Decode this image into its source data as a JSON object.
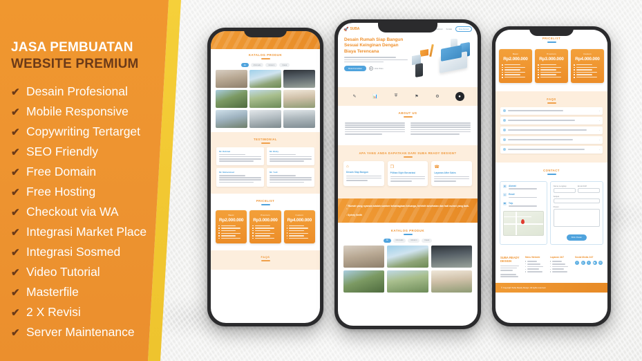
{
  "promo": {
    "title_line1": "JASA PEMBUATAN",
    "title_line2": "WEBSITE PREMIUM",
    "check_glyph": "✔",
    "features": [
      "Desain Profesional",
      "Mobile Responsive",
      "Copywriting Tertarget",
      "SEO Friendly",
      "Free Domain",
      "Free Hosting",
      "Checkout via WA",
      "Integrasi Market Place",
      "Integrasi Sosmed",
      "Video Tutorial",
      "Masterfile",
      "2 X Revisi",
      "Server Maintenance"
    ],
    "colors": {
      "panel_orange": "#ed9330",
      "accent_yellow": "#f2c832",
      "title_brown": "#6b3a18",
      "title_white": "#ffffff"
    }
  },
  "phone_left": {
    "catalog": {
      "heading": "KATALOG PRODUK",
      "filters": [
        "All",
        "Minimalis",
        "Modern",
        "Klasik"
      ],
      "active_filter": "All"
    },
    "testimonial": {
      "heading": "TESTIMONIAL",
      "cards": [
        {
          "name": "Mr. Rahmat"
        },
        {
          "name": "Mr. Rizky"
        },
        {
          "name": "Mr. Muhammad"
        },
        {
          "name": "Mr. Yudi"
        }
      ]
    },
    "pricelist": {
      "heading": "PRICELIST",
      "plans": [
        {
          "tier": "Basic",
          "price": "Rp2.000.000",
          "feature_count": 6
        },
        {
          "tier": "Premium",
          "price": "Rp3.000.000",
          "feature_count": 6
        },
        {
          "tier": "Custom",
          "price": "Rp4.000.000",
          "feature_count": 6
        }
      ]
    },
    "faqs_heading": "FAQS"
  },
  "phone_center": {
    "brand": {
      "logo_text": "SUBA",
      "logo_icon": "rocket-icon"
    },
    "nav": {
      "items": [
        "Home",
        "About",
        "Layanan",
        "Produk",
        "Testimoni",
        "Kontak"
      ],
      "active": "Home",
      "cta": "Free Konsul"
    },
    "hero": {
      "title": "Desain Rumah Siap Bangun Sesuai Keinginan Dengan Biaya Terencana",
      "primary_button": "Mulai Konsultasi",
      "play_button": "Lihat Video"
    },
    "about": {
      "heading": "ABOUT US"
    },
    "benefits": {
      "heading": "APA YANG ANDA DAPATKAN DARI SUBA READY DESIGN?",
      "cards": [
        {
          "title": "Desain Siap Bangun",
          "icon": "house-icon"
        },
        {
          "title": "Pilihan Style Bervariasi",
          "icon": "layers-icon"
        },
        {
          "title": "Layanan After Sales",
          "icon": "headset-icon"
        }
      ]
    },
    "quote": {
      "text": "\" Rumah yang nyaman adalah sumber kebahagiaan keluarga, terlebih kesehatan dan hati nurani yang baik. \"",
      "author": ": Sydney Smith"
    },
    "catalog": {
      "heading": "KATALOG PRODUK",
      "filters": [
        "All",
        "Minimalis",
        "Modern",
        "Klasik"
      ],
      "active_filter": "All"
    }
  },
  "phone_right": {
    "pricelist": {
      "heading": "PRICELIST",
      "plans": [
        {
          "tier": "Basic",
          "price": "Rp2.000.000",
          "feature_count": 6
        },
        {
          "tier": "Premium",
          "price": "Rp3.000.000",
          "feature_count": 6
        },
        {
          "tier": "Custom",
          "price": "Rp4.000.000",
          "feature_count": 6
        }
      ]
    },
    "faqs": {
      "heading": "FAQS",
      "rows": 5,
      "chevron": "›"
    },
    "contact": {
      "heading": "CONTACT",
      "info": [
        {
          "title": "Alamat",
          "icon": "location-icon"
        },
        {
          "title": "Email",
          "icon": "mail-icon"
        },
        {
          "title": "Telp",
          "icon": "phone-icon"
        }
      ],
      "form": {
        "name_label": "Nama Lengkap",
        "email_label": "Email Aktif",
        "subject_label": "Subjek",
        "message_label": "Pesan",
        "submit": "Kirim Pesan"
      }
    },
    "footer": {
      "brand": "SUBA READY DESIGN",
      "columns": [
        {
          "heading": "Menu Website",
          "items": 5
        },
        {
          "heading": "Layanan 24/7",
          "items": 5
        }
      ],
      "social_heading": "Sosial Media 24/7",
      "socials": [
        "facebook-icon",
        "instagram-icon",
        "twitter-icon",
        "youtube-icon",
        "whatsapp-icon"
      ],
      "copyright": "© Copyright Suba Ready Design. All rights reserved."
    }
  }
}
